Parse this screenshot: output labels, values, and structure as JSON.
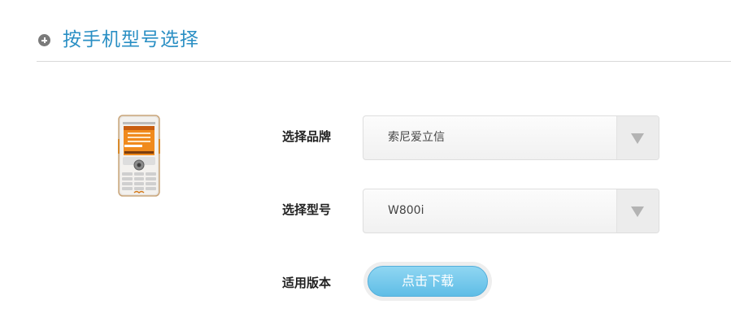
{
  "header": {
    "title": "按手机型号选择",
    "icon": "plus-circle-icon"
  },
  "form": {
    "brand_label": "选择品牌",
    "brand_value": "索尼爱立信",
    "model_label": "选择型号",
    "model_value": "W800i",
    "version_label": "适用版本",
    "download_label": "点击下载"
  },
  "phone_image": {
    "icon": "mobile-phone-image"
  },
  "colors": {
    "title": "#2a8fc4",
    "button": "#6cc5ea"
  }
}
